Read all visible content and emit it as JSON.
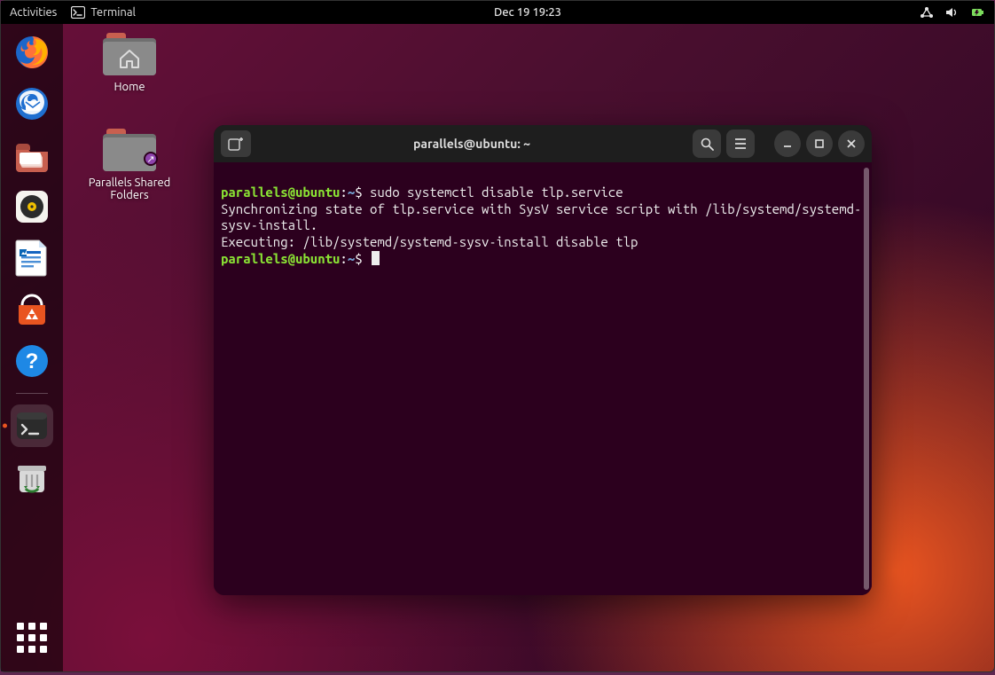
{
  "topbar": {
    "activities": "Activities",
    "app_label": "Terminal",
    "clock": "Dec 19  19:23"
  },
  "dock": {
    "items": [
      {
        "name": "firefox-icon"
      },
      {
        "name": "thunderbird-icon"
      },
      {
        "name": "files-icon"
      },
      {
        "name": "rhythmbox-icon"
      },
      {
        "name": "libreoffice-writer-icon"
      },
      {
        "name": "software-center-icon"
      },
      {
        "name": "help-icon"
      },
      {
        "name": "terminal-icon"
      },
      {
        "name": "trash-icon"
      }
    ]
  },
  "desktop_icons": {
    "home": "Home",
    "shared": "Parallels Shared Folders"
  },
  "terminal": {
    "title": "parallels@ubuntu: ~",
    "prompt_user_host": "parallels@ubuntu",
    "prompt_sep": ":",
    "prompt_path": "~",
    "prompt_symbol": "$",
    "lines": {
      "cmd1": "sudo systemctl disable tlp.service",
      "out1": "Synchronizing state of tlp.service with SysV service script with /lib/systemd/systemd-sysv-install.",
      "out2": "Executing: /lib/systemd/systemd-sysv-install disable tlp"
    }
  }
}
